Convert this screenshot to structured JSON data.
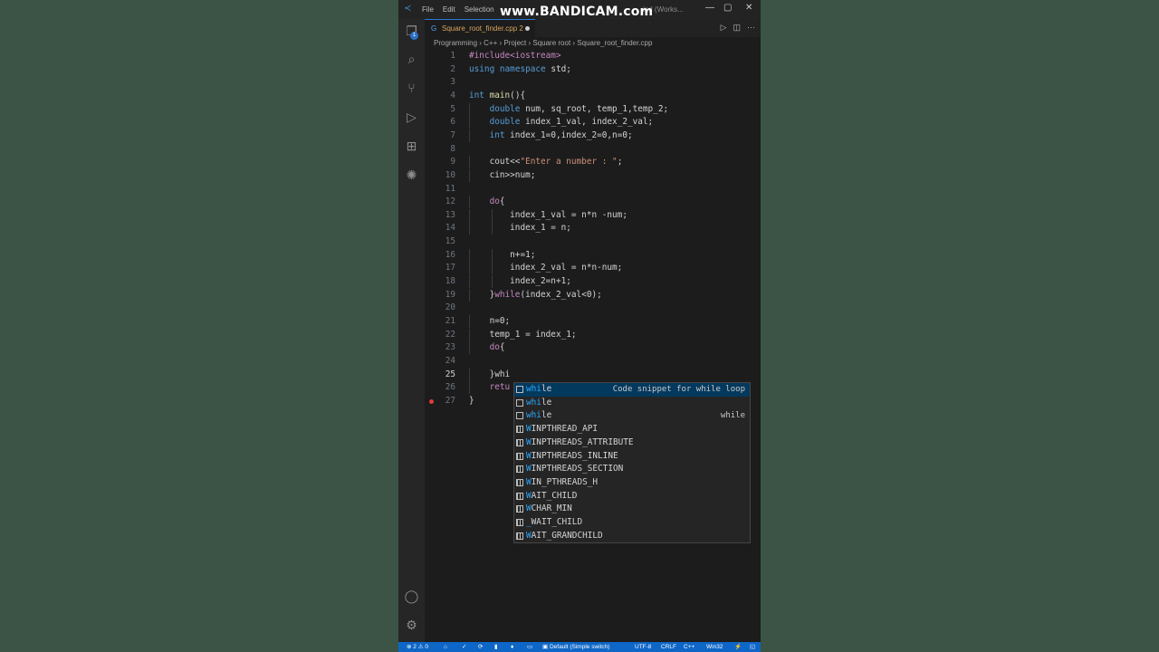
{
  "watermark": "www.BANDICAM.com",
  "titlebar": {
    "menu": [
      "File",
      "Edit",
      "Selection"
    ],
    "window_title_fragment": "ind (Works...",
    "controls": [
      "—",
      "▢",
      "✕"
    ]
  },
  "tab": {
    "filename": "Square_root_finder.cpp",
    "problems": "2"
  },
  "breadcrumb": "Programming  ›  C++  ›  Project  ›  Square root  ›  Square_root_finder.cpp",
  "code_lines": [
    {
      "n": "1",
      "t": "#include<iostream>"
    },
    {
      "n": "2",
      "t": "using namespace std;"
    },
    {
      "n": "3",
      "t": ""
    },
    {
      "n": "4",
      "t": "int main(){"
    },
    {
      "n": "5",
      "t": "    double num, sq_root, temp_1,temp_2;"
    },
    {
      "n": "6",
      "t": "    double index_1_val, index_2_val;"
    },
    {
      "n": "7",
      "t": "    int index_1=0,index_2=0,n=0;"
    },
    {
      "n": "8",
      "t": ""
    },
    {
      "n": "9",
      "t": "    cout<<\"Enter a number : \";"
    },
    {
      "n": "10",
      "t": "    cin>>num;"
    },
    {
      "n": "11",
      "t": ""
    },
    {
      "n": "12",
      "t": "    do{"
    },
    {
      "n": "13",
      "t": "        index_1_val = n*n -num;"
    },
    {
      "n": "14",
      "t": "        index_1 = n;"
    },
    {
      "n": "15",
      "t": ""
    },
    {
      "n": "16",
      "t": "        n+=1;"
    },
    {
      "n": "17",
      "t": "        index_2_val = n*n-num;"
    },
    {
      "n": "18",
      "t": "        index_2=n+1;"
    },
    {
      "n": "19",
      "t": "    }while(index_2_val<0);"
    },
    {
      "n": "20",
      "t": ""
    },
    {
      "n": "21",
      "t": "    n=0;"
    },
    {
      "n": "22",
      "t": "    temp_1 = index_1;"
    },
    {
      "n": "23",
      "t": "    do{"
    },
    {
      "n": "24",
      "t": ""
    },
    {
      "n": "25",
      "t": "    }whi"
    },
    {
      "n": "26",
      "t": "    retu"
    },
    {
      "n": "27",
      "t": "}"
    }
  ],
  "suggestions": [
    {
      "label": "while",
      "match": "whi",
      "detail": "Code snippet for while loop",
      "kind": "snippet"
    },
    {
      "label": "while",
      "match": "whi",
      "detail": "",
      "kind": "snippet"
    },
    {
      "label": "while",
      "match": "whi",
      "detail": "while",
      "kind": "keyword"
    },
    {
      "label": "WINPTHREAD_API",
      "match": "",
      "detail": "",
      "kind": "macro"
    },
    {
      "label": "WINPTHREADS_ATTRIBUTE",
      "match": "",
      "detail": "",
      "kind": "macro"
    },
    {
      "label": "WINPTHREADS_INLINE",
      "match": "",
      "detail": "",
      "kind": "macro"
    },
    {
      "label": "WINPTHREADS_SECTION",
      "match": "",
      "detail": "",
      "kind": "macro"
    },
    {
      "label": "WIN_PTHREADS_H",
      "match": "",
      "detail": "",
      "kind": "macro"
    },
    {
      "label": "WAIT_CHILD",
      "match": "",
      "detail": "",
      "kind": "macro"
    },
    {
      "label": "WCHAR_MIN",
      "match": "",
      "detail": "",
      "kind": "macro"
    },
    {
      "label": "_WAIT_CHILD",
      "match": "",
      "detail": "",
      "kind": "macro"
    },
    {
      "label": "WAIT_GRANDCHILD",
      "match": "",
      "detail": "",
      "kind": "macro"
    }
  ],
  "statusbar": {
    "errors": "2",
    "warnings": "0",
    "config": "Default (Simple switch)",
    "encoding": "UTF-8",
    "eol": "CRLF",
    "language": "C++",
    "platform": "Win32"
  },
  "colors": {
    "background": "#3c5546",
    "editor": "#1c1c1c",
    "statusbar": "#0e66c7",
    "keyword": "#569cd6",
    "control": "#c586c0",
    "string": "#ce9178",
    "match_highlight": "#2aaaff"
  }
}
